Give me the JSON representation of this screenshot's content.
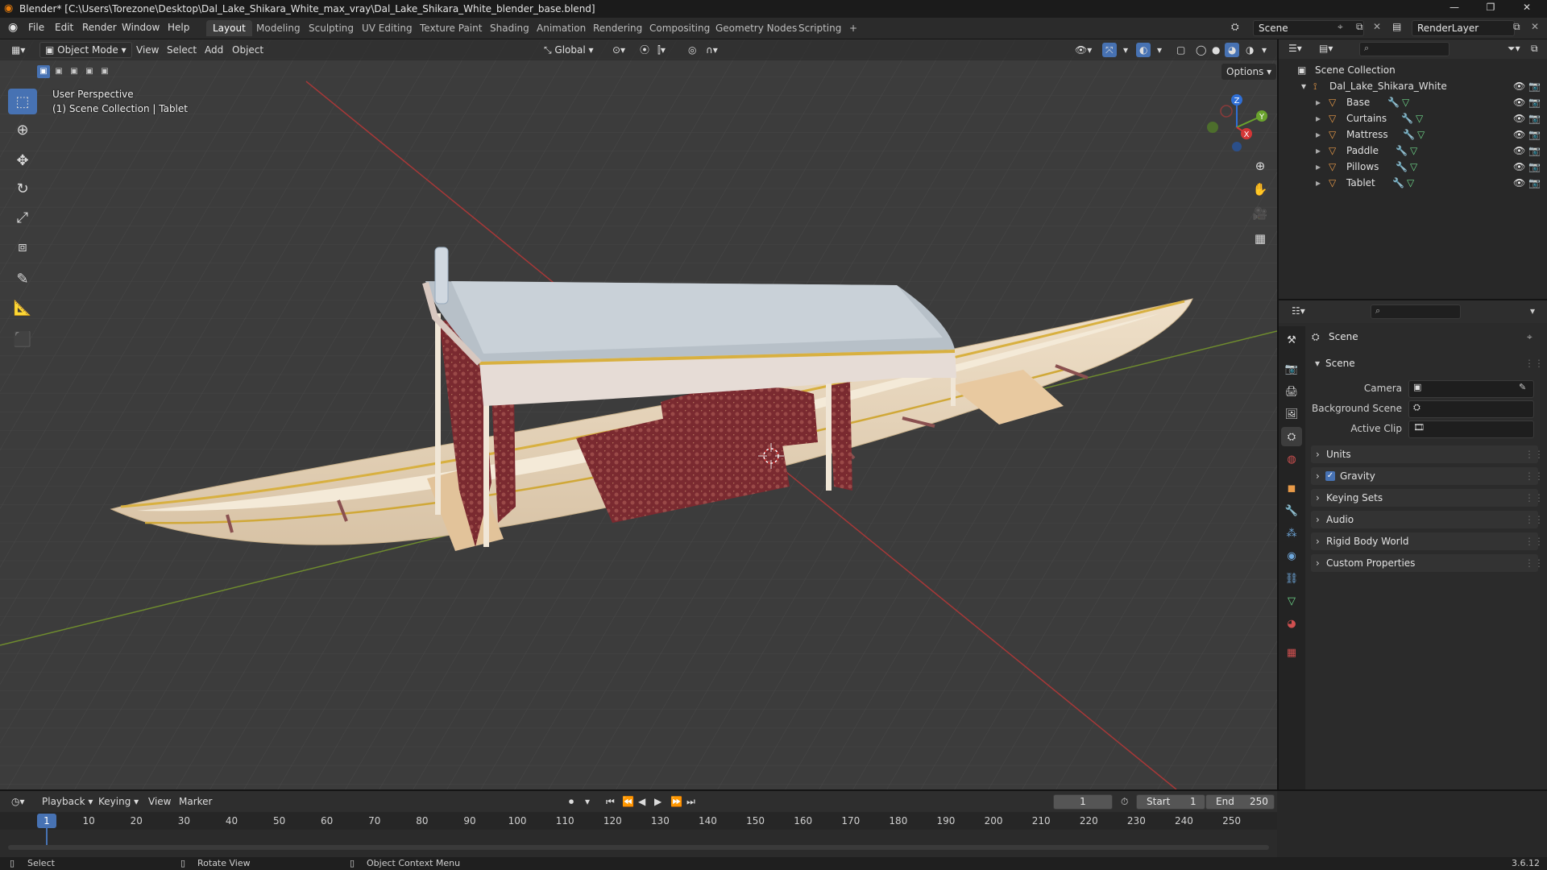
{
  "window": {
    "title": "Blender* [C:\\Users\\Torezone\\Desktop\\Dal_Lake_Shikara_White_max_vray\\Dal_Lake_Shikara_White_blender_base.blend]",
    "minimize": "—",
    "maximize": "❐",
    "close": "✕"
  },
  "menu": {
    "items": [
      "File",
      "Edit",
      "Render",
      "Window",
      "Help"
    ],
    "workspaces": [
      "Layout",
      "Modeling",
      "Sculpting",
      "UV Editing",
      "Texture Paint",
      "Shading",
      "Animation",
      "Rendering",
      "Compositing",
      "Geometry Nodes",
      "Scripting"
    ],
    "active_workspace": "Layout",
    "add_tab": "+",
    "scene_name": "Scene",
    "render_layer": "RenderLayer"
  },
  "viewport": {
    "mode": "Object Mode",
    "header_menus": [
      "View",
      "Select",
      "Add",
      "Object"
    ],
    "transform_orientation": "Global",
    "options_label": "Options",
    "perspective_label": "User Perspective",
    "collection_label": "(1) Scene Collection | Tablet",
    "gizmo_axes": {
      "x": "X",
      "y": "Y",
      "z": "Z"
    }
  },
  "outliner": {
    "root": "Scene Collection",
    "collection": "Dal_Lake_Shikara_White",
    "objects": [
      "Base",
      "Curtains",
      "Mattress",
      "Paddle",
      "Pillows",
      "Tablet"
    ]
  },
  "properties": {
    "header": "Scene",
    "section": "Scene",
    "fields": [
      {
        "label": "Camera"
      },
      {
        "label": "Background Scene"
      },
      {
        "label": "Active Clip"
      }
    ],
    "panels": [
      "Units",
      "Gravity",
      "Keying Sets",
      "Audio",
      "Rigid Body World",
      "Custom Properties"
    ],
    "gravity_checked": true
  },
  "timeline": {
    "menus": [
      "Playback",
      "Keying",
      "View",
      "Marker"
    ],
    "current_frame": "1",
    "start_label": "Start",
    "start": "1",
    "end_label": "End",
    "end": "250",
    "ticks": [
      "1",
      "10",
      "20",
      "30",
      "40",
      "50",
      "60",
      "70",
      "80",
      "90",
      "100",
      "110",
      "120",
      "130",
      "140",
      "150",
      "160",
      "170",
      "180",
      "190",
      "200",
      "210",
      "220",
      "230",
      "240",
      "250"
    ]
  },
  "statusbar": {
    "select": "Select",
    "rotate": "Rotate View",
    "context_menu": "Object Context Menu",
    "version": "3.6.12"
  }
}
